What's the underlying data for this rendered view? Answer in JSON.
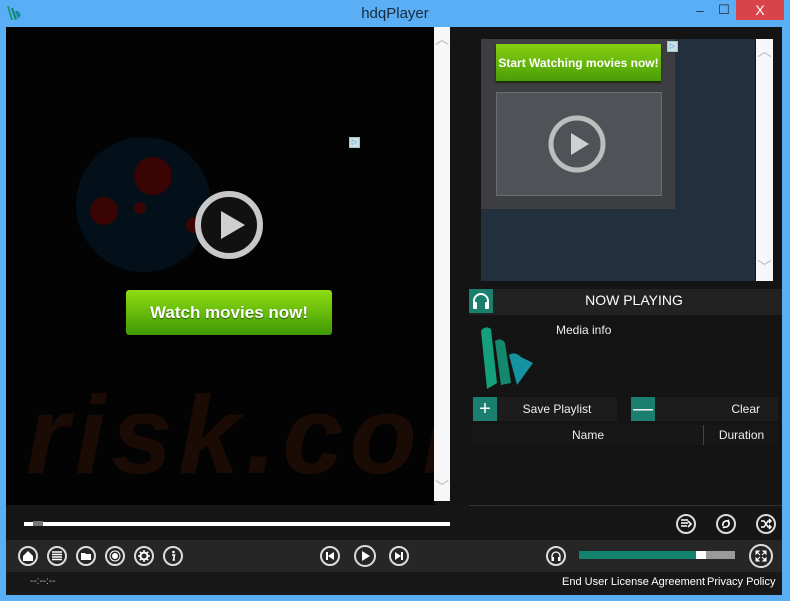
{
  "window": {
    "title": "hdqPlayer",
    "minimize_label": "‒",
    "maximize_label": "☐",
    "close_label": "X"
  },
  "video": {
    "cta_label": "Watch movies now!",
    "watermark": "risk.com",
    "adchoices_label": "▷"
  },
  "ad": {
    "cta_label": "Start Watching movies now!",
    "adchoices_label": "▷"
  },
  "now_playing": {
    "title": "NOW PLAYING",
    "media_info": "Media info"
  },
  "playlist": {
    "add_label": "+",
    "save_label": "Save Playlist",
    "remove_label": "—",
    "clear_label": "Clear",
    "columns": [
      "Name",
      "Duration"
    ],
    "rows": []
  },
  "player": {
    "seek_progress": 0.02,
    "volume": 0.76,
    "time": "--:--:--",
    "left_buttons": [
      "home-icon",
      "playlist-icon",
      "folder-icon",
      "record-icon",
      "settings-icon",
      "info-icon"
    ],
    "transport_buttons": [
      "previous-icon",
      "play-icon",
      "next-icon"
    ],
    "right_buttons": [
      "queue-icon",
      "repeat-icon",
      "shuffle-icon"
    ]
  },
  "footer": {
    "eula_label": "End User License Agreement",
    "privacy_label": "Privacy Policy"
  },
  "colors": {
    "accent": "#13836d",
    "titlebar": "#5aaef5",
    "close": "#d9434a",
    "cta_green": "#6cc00a"
  }
}
